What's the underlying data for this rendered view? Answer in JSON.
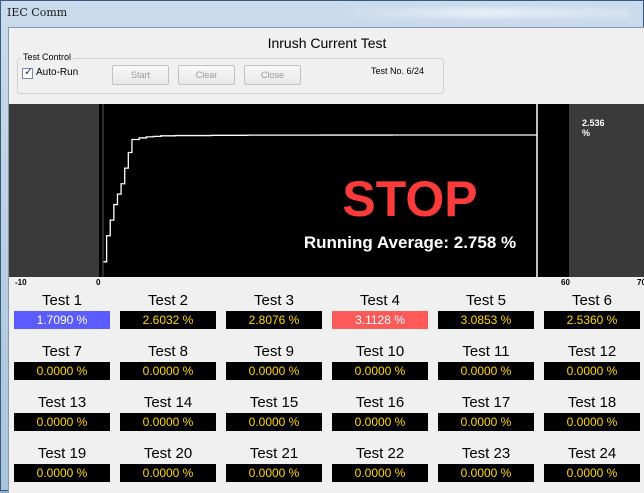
{
  "window": {
    "title": "IEC Comm"
  },
  "form": {
    "title": "Inrush Current Test"
  },
  "test_control": {
    "group_label": "Test Control",
    "auto_run_label": "Auto-Run",
    "auto_run_checked": true,
    "start_label": "Start",
    "clear_label": "Clear",
    "close_label": "Close",
    "test_no": "Test No. 6/24"
  },
  "chart": {
    "marker_label": "2.536 %",
    "status_text": "STOP",
    "running_average": "Running Average: 2.758 %",
    "axis_ticks": [
      "-10",
      "0",
      "60",
      "70"
    ]
  },
  "chart_data": {
    "type": "line",
    "x": [
      0,
      0.5,
      1,
      1.5,
      2,
      2.5,
      3,
      3.5,
      4,
      5,
      6,
      7,
      8,
      10,
      15,
      20,
      30,
      40,
      50,
      60
    ],
    "values": [
      0.1,
      0.6,
      0.9,
      1.2,
      1.4,
      1.6,
      1.9,
      2.2,
      2.45,
      2.48,
      2.5,
      2.51,
      2.52,
      2.525,
      2.53,
      2.533,
      2.535,
      2.536,
      2.536,
      2.536
    ],
    "xlim": [
      -10,
      70
    ],
    "marker_x": 60
  },
  "tests": [
    {
      "name": "Test 1",
      "value": "1.7090 %",
      "bg": "#5b5bff",
      "fg": "#ffffff"
    },
    {
      "name": "Test 2",
      "value": "2.6032 %",
      "bg": "#000000",
      "fg": "#ffd500"
    },
    {
      "name": "Test 3",
      "value": "2.8076 %",
      "bg": "#000000",
      "fg": "#ffd500"
    },
    {
      "name": "Test 4",
      "value": "3.1128 %",
      "bg": "#ff5a5a",
      "fg": "#ffffff"
    },
    {
      "name": "Test 5",
      "value": "3.0853 %",
      "bg": "#000000",
      "fg": "#ffd500"
    },
    {
      "name": "Test 6",
      "value": "2.5360 %",
      "bg": "#000000",
      "fg": "#ffd500"
    },
    {
      "name": "Test 7",
      "value": "0.0000 %",
      "bg": "#000000",
      "fg": "#ffd500"
    },
    {
      "name": "Test 8",
      "value": "0.0000 %",
      "bg": "#000000",
      "fg": "#ffd500"
    },
    {
      "name": "Test 9",
      "value": "0.0000 %",
      "bg": "#000000",
      "fg": "#ffd500"
    },
    {
      "name": "Test 10",
      "value": "0.0000 %",
      "bg": "#000000",
      "fg": "#ffd500"
    },
    {
      "name": "Test 11",
      "value": "0.0000 %",
      "bg": "#000000",
      "fg": "#ffd500"
    },
    {
      "name": "Test 12",
      "value": "0.0000 %",
      "bg": "#000000",
      "fg": "#ffd500"
    },
    {
      "name": "Test 13",
      "value": "0.0000 %",
      "bg": "#000000",
      "fg": "#ffd500"
    },
    {
      "name": "Test 14",
      "value": "0.0000 %",
      "bg": "#000000",
      "fg": "#ffd500"
    },
    {
      "name": "Test 15",
      "value": "0.0000 %",
      "bg": "#000000",
      "fg": "#ffd500"
    },
    {
      "name": "Test 16",
      "value": "0.0000 %",
      "bg": "#000000",
      "fg": "#ffd500"
    },
    {
      "name": "Test 17",
      "value": "0.0000 %",
      "bg": "#000000",
      "fg": "#ffd500"
    },
    {
      "name": "Test 18",
      "value": "0.0000 %",
      "bg": "#000000",
      "fg": "#ffd500"
    },
    {
      "name": "Test 19",
      "value": "0.0000 %",
      "bg": "#000000",
      "fg": "#ffd500"
    },
    {
      "name": "Test 20",
      "value": "0.0000 %",
      "bg": "#000000",
      "fg": "#ffd500"
    },
    {
      "name": "Test 21",
      "value": "0.0000 %",
      "bg": "#000000",
      "fg": "#ffd500"
    },
    {
      "name": "Test 22",
      "value": "0.0000 %",
      "bg": "#000000",
      "fg": "#ffd500"
    },
    {
      "name": "Test 23",
      "value": "0.0000 %",
      "bg": "#000000",
      "fg": "#ffd500"
    },
    {
      "name": "Test 24",
      "value": "0.0000 %",
      "bg": "#000000",
      "fg": "#ffd500"
    }
  ]
}
